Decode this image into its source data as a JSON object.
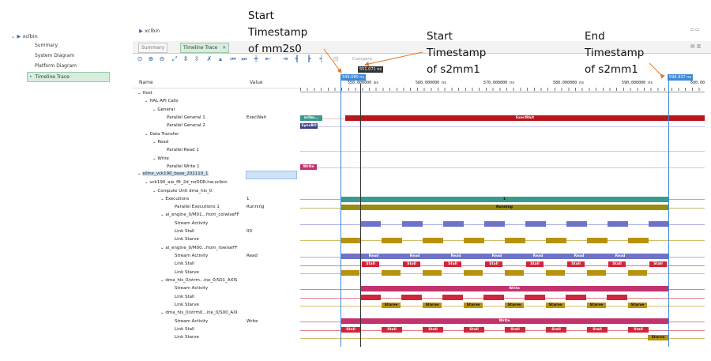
{
  "nav": {
    "root": "xclbin",
    "items": [
      "Summary",
      "System Diagram",
      "Platform Diagram",
      "Timeline Trace"
    ]
  },
  "editor": {
    "breadcrumb": "xclbin",
    "tabs": [
      "Summary",
      "Timeline Trace"
    ],
    "compare_label": "Compare"
  },
  "columns": {
    "name": "Name",
    "value": "Value"
  },
  "tree": [
    {
      "label": "Host",
      "value": ""
    },
    {
      "label": "HAL API Calls",
      "value": ""
    },
    {
      "label": "General",
      "value": ""
    },
    {
      "label": "Parallel General 1",
      "value": "ExecWait"
    },
    {
      "label": "Parallel General 2",
      "value": ""
    },
    {
      "label": "Data Transfer",
      "value": ""
    },
    {
      "label": "Read",
      "value": ""
    },
    {
      "label": "Parallel Read 1",
      "value": ""
    },
    {
      "label": "Write",
      "value": ""
    },
    {
      "label": "Parallel Write 1",
      "value": ""
    },
    {
      "label": "xilinx_vck190_base_202110_1",
      "value": ""
    },
    {
      "label": "vck190_aie_fft_2d_noDDR.hw.xclbin",
      "value": ""
    },
    {
      "label": "Compute Unit dma_hls_0",
      "value": ""
    },
    {
      "label": "Executions",
      "value": "1"
    },
    {
      "label": "Parallel Executions 1",
      "value": "Running"
    },
    {
      "label": "ai_engine_0/M01...from_colwiseFF",
      "value": ""
    },
    {
      "label": "Stream Activity",
      "value": ""
    },
    {
      "label": "Link Stall",
      "value": "00"
    },
    {
      "label": "Link Starve",
      "value": ""
    },
    {
      "label": "ai_engine_0/M00...from_rowiseFF",
      "value": ""
    },
    {
      "label": "Stream Activity",
      "value": "Read"
    },
    {
      "label": "Link Stall",
      "value": ""
    },
    {
      "label": "Link Starve",
      "value": ""
    },
    {
      "label": "dma_hls_0/strm...ine_0/S01_AXIS",
      "value": ""
    },
    {
      "label": "Stream Activity",
      "value": ""
    },
    {
      "label": "Link Stall",
      "value": ""
    },
    {
      "label": "Link Starve",
      "value": ""
    },
    {
      "label": "dma_hls_0/strm0...ine_0/S00_AXI",
      "value": ""
    },
    {
      "label": "Stream Activity",
      "value": "Write"
    },
    {
      "label": "Link Stall",
      "value": ""
    },
    {
      "label": "Link Starve",
      "value": ""
    }
  ],
  "timeline": {
    "ticks": [
      "550.000000 es",
      "560.000000 ns",
      "570.000000 ns",
      "580.000000 ns",
      "590.000000 ns",
      "600.00"
    ],
    "marker_start": "549.080 ns",
    "marker_mid": "551.071 ns",
    "marker_end": "596.937 ns"
  },
  "trace_labels": {
    "exec_wait": "ExecWait",
    "xclb": "xclbo...",
    "syncbo": "SyncBO",
    "write": "Write",
    "one": "1",
    "running": "Running",
    "read": "Read",
    "stall": "Stall",
    "starve": "Starve"
  },
  "annotations": {
    "a1": "Start\nTimestamp\nof mm2s0",
    "a2": "Start\nTimestamp\nof s2mm1",
    "a3": "End\nTimestamp\nof s2mm1"
  },
  "colors": {
    "teal": "#3a9a8e",
    "olive": "#9a8c0e",
    "purple": "#6e73c8",
    "gold": "#b8920c",
    "red": "#d0253a",
    "magenta": "#c2336e",
    "darkred": "#b8161c",
    "marker_blue": "#3b8ad8"
  }
}
